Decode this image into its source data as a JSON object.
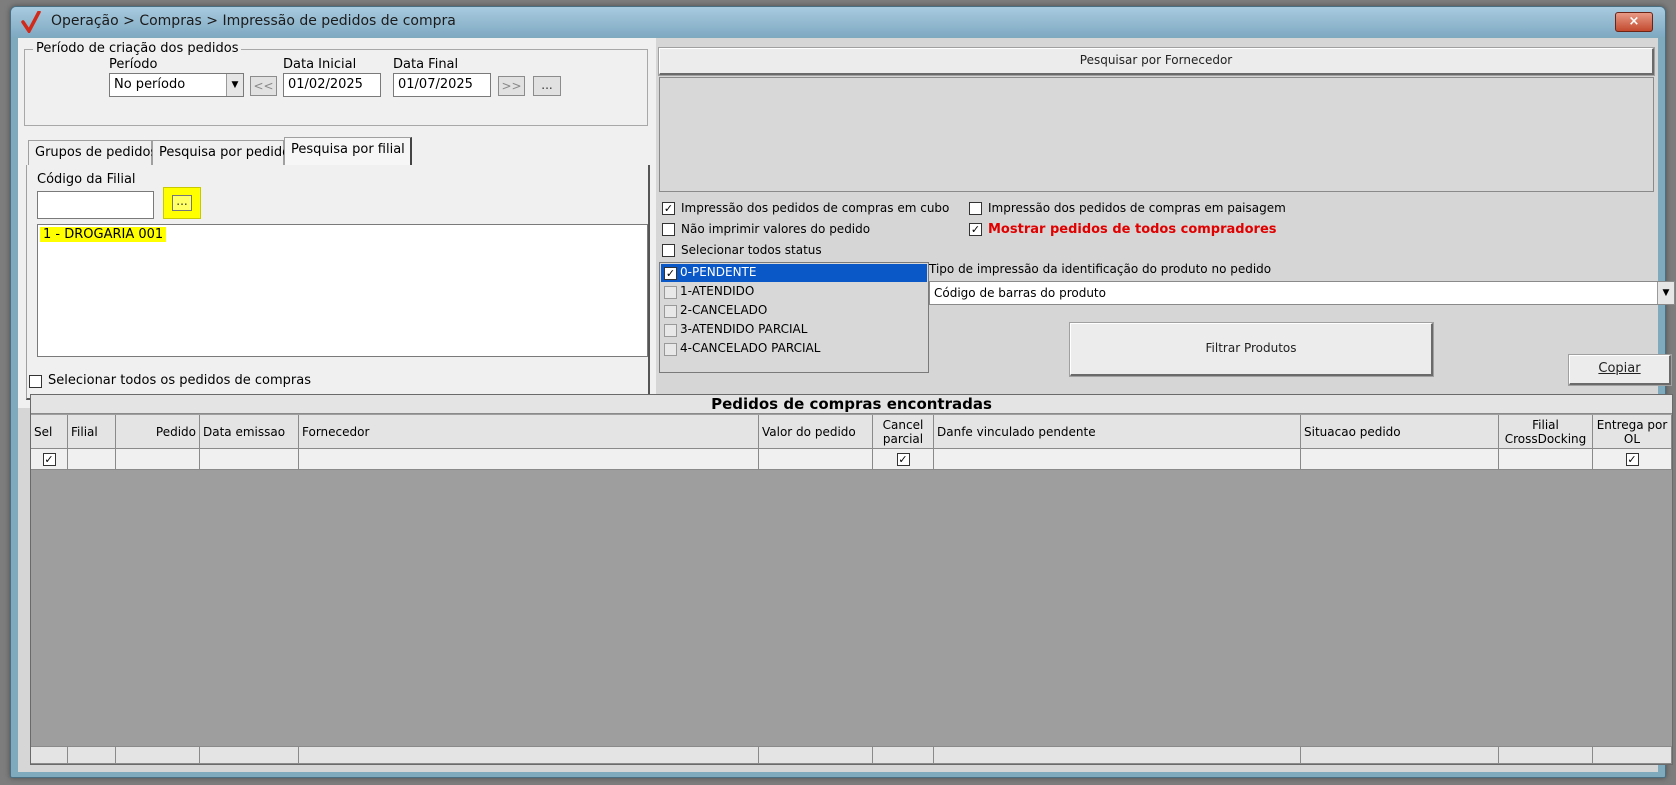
{
  "window": {
    "title": "Operação > Compras > Impressão de pedidos de compra",
    "close_label": "×"
  },
  "periodo_group": {
    "legend": "Período de criação dos pedidos",
    "periodo_label": "Período",
    "periodo_value": "No período",
    "data_inicial_label": "Data Inicial",
    "data_inicial_value": "01/02/2025",
    "data_final_label": "Data Final",
    "data_final_value": "01/07/2025",
    "prev_label": "<<",
    "next_label": ">>",
    "more_label": "..."
  },
  "tabs": [
    {
      "label": "Grupos de pedidos"
    },
    {
      "label": "Pesquisa por pedido"
    },
    {
      "label": "Pesquisa por filial"
    }
  ],
  "filial_tab": {
    "codigo_label": "Código da Filial",
    "codigo_value": "",
    "search_label": "...",
    "items": [
      "1 - DROGARIA 001"
    ]
  },
  "select_all_orders_label": "Selecionar todos os pedidos de compras",
  "fornecedor": {
    "header_label": "Pesquisar por Fornecedor"
  },
  "options": {
    "cubo_label": "Impressão dos pedidos de compras em cubo",
    "cubo_checked": true,
    "paisagem_label": "Impressão dos pedidos de compras em paisagem",
    "paisagem_checked": false,
    "nao_valores_label": "Não imprimir valores do pedido",
    "nao_valores_checked": false,
    "mostrar_label": "Mostrar pedidos de todos compradores",
    "mostrar_checked": true,
    "todos_status_label": "Selecionar todos status",
    "todos_status_checked": false
  },
  "status_list": [
    {
      "label": "0-PENDENTE",
      "checked": true
    },
    {
      "label": "1-ATENDIDO",
      "checked": false
    },
    {
      "label": "2-CANCELADO",
      "checked": false
    },
    {
      "label": "3-ATENDIDO PARCIAL",
      "checked": false
    },
    {
      "label": "4-CANCELADO PARCIAL",
      "checked": false
    }
  ],
  "tipo_impressao": {
    "label": "Tipo de impressão da identificação do produto no pedido",
    "value": "Código de barras do produto"
  },
  "filtrar_label": "Filtrar Produtos",
  "copiar_label": "Copiar",
  "grid": {
    "title": "Pedidos de compras encontradas",
    "columns": [
      {
        "label": "Sel"
      },
      {
        "label": "Filial"
      },
      {
        "label": "Pedido"
      },
      {
        "label": "Data emissao"
      },
      {
        "label": "Fornecedor"
      },
      {
        "label": "Valor do pedido"
      },
      {
        "label": "Cancel parcial"
      },
      {
        "label": "Danfe vinculado pendente"
      },
      {
        "label": "Situacao pedido"
      },
      {
        "label": "Filial CrossDocking"
      },
      {
        "label": "Entrega por OL"
      }
    ],
    "row": {
      "sel_checked": true,
      "cancel_checked": true,
      "entrega_checked": true
    }
  },
  "colors": {
    "highlight_yellow": "#ffff00",
    "selection_blue": "#0a58c8",
    "warning_red": "#e00000"
  }
}
